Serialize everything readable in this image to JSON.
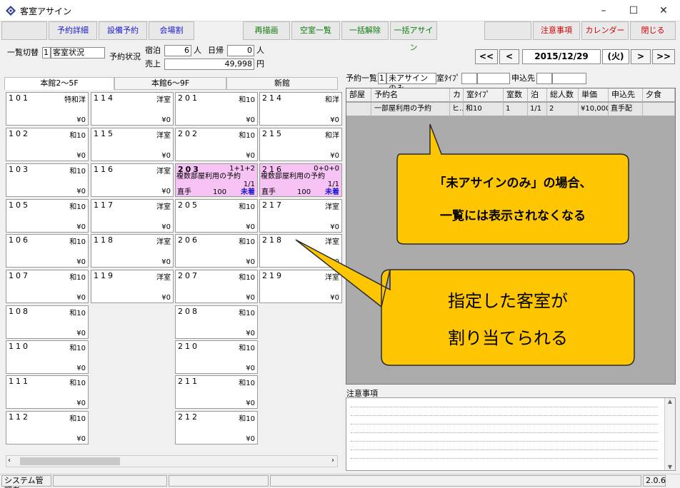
{
  "window": {
    "title": "客室アサイン",
    "minimize": "–",
    "maximize": "☐",
    "close": "✕"
  },
  "toolbar": {
    "yoyaku_shosai": "予約詳細",
    "setsubi_yoyaku": "設備予約",
    "kaijowari": "会場割",
    "saibyoga": "再描画",
    "kushitsu_ichiran": "空室一覧",
    "ikkatsu_kaijo": "一括解除",
    "ikkatsu_assign": "一括アサイン",
    "chuijiko": "注意事項",
    "calendar": "カレンダー",
    "tojiru": "閉じる"
  },
  "info": {
    "ichiran_kirikae_label": "一覧切替",
    "ichiran_kirikae_num": "1",
    "ichiran_kirikae_value": "客室状況",
    "yoyaku_jokyo_label": "予約状況",
    "shukuhaku_label": "宿泊",
    "shukuhaku_value": "6",
    "nin1": "人",
    "higaeri_label": "日帰",
    "higaeri_value": "0",
    "nin2": "人",
    "uriage_label": "売上",
    "uriage_value": "49,998",
    "yen": "円"
  },
  "datenav": {
    "first": "<<",
    "prev": "<",
    "date": "2015/12/29",
    "weekday": "(火)",
    "next": ">",
    "last": ">>"
  },
  "tabs": [
    "本館2～5F",
    "本館6～9F",
    "新館"
  ],
  "rooms": [
    {
      "no": "101",
      "type": "特和洋",
      "price": "¥0"
    },
    {
      "no": "114",
      "type": "洋室",
      "price": "¥0"
    },
    {
      "no": "201",
      "type": "和10",
      "price": "¥0"
    },
    {
      "no": "214",
      "type": "和洋",
      "price": "¥0"
    },
    {
      "no": "102",
      "type": "和10",
      "price": "¥0"
    },
    {
      "no": "115",
      "type": "洋室",
      "price": "¥0"
    },
    {
      "no": "202",
      "type": "和10",
      "price": "¥0"
    },
    {
      "no": "215",
      "type": "和洋",
      "price": "¥0"
    },
    {
      "no": "103",
      "type": "和10",
      "price": "¥0"
    },
    {
      "no": "116",
      "type": "洋室",
      "price": "¥0"
    },
    {
      "no": "105",
      "type": "和10",
      "price": "¥0"
    },
    {
      "no": "117",
      "type": "洋室",
      "price": "¥0"
    },
    {
      "no": "205",
      "type": "和10",
      "price": "¥0"
    },
    {
      "no": "217",
      "type": "洋室",
      "price": "¥0"
    },
    {
      "no": "106",
      "type": "和10",
      "price": "¥0"
    },
    {
      "no": "118",
      "type": "洋室",
      "price": "¥0"
    },
    {
      "no": "206",
      "type": "和10",
      "price": "¥0"
    },
    {
      "no": "218",
      "type": "洋室",
      "price": "¥0"
    },
    {
      "no": "107",
      "type": "和10",
      "price": "¥0"
    },
    {
      "no": "119",
      "type": "洋室",
      "price": "¥0"
    },
    {
      "no": "207",
      "type": "和10",
      "price": "¥0"
    },
    {
      "no": "219",
      "type": "洋室",
      "price": "¥0"
    },
    {
      "no": "108",
      "type": "和10",
      "price": "¥0"
    },
    {
      "no": "208",
      "type": "和10",
      "price": "¥0"
    },
    {
      "no": "110",
      "type": "和10",
      "price": "¥0"
    },
    {
      "no": "210",
      "type": "和10",
      "price": "¥0"
    },
    {
      "no": "111",
      "type": "和10",
      "price": "¥0"
    },
    {
      "no": "211",
      "type": "和10",
      "price": "¥0"
    },
    {
      "no": "112",
      "type": "和10",
      "price": "¥0"
    },
    {
      "no": "212",
      "type": "和10",
      "price": "¥0"
    }
  ],
  "booked": [
    {
      "no": "203",
      "count": "1+1+2",
      "name": "複数部屋利用の予約",
      "ratio": "1/1",
      "agent": "直手",
      "num": "100",
      "status": "未着"
    },
    {
      "no": "216",
      "count": "0+0+0",
      "name": "複数部屋利用の予約",
      "ratio": "1/1",
      "agent": "直手",
      "num": "100",
      "status": "未着"
    }
  ],
  "list": {
    "label": "予約一覧",
    "num": "1",
    "value": "未アサインのみ",
    "roomtype_label": "室ﾀｲﾌﾟ",
    "moshikomi_label": "申込先",
    "headers": [
      "部屋",
      "予約名",
      "カ",
      "室ﾀｲﾌﾟ",
      "室数",
      "泊",
      "総人数",
      "単価",
      "申込先",
      "夕食"
    ],
    "row": [
      "",
      "一部屋利用の予約",
      "ヒ..",
      "和10",
      "1",
      "1/1",
      "2",
      "¥10,000",
      "直手配",
      ""
    ]
  },
  "callouts": {
    "top_line1": "「未アサインのみ」の場合、",
    "top_line2": "一覧には表示されなくなる",
    "bottom_line1": "指定した客室が",
    "bottom_line2": "割り当てられる"
  },
  "notes": {
    "label": "注意事項"
  },
  "status": {
    "user": "システム管理者",
    "version": "2.0.6"
  },
  "colors": {
    "callout_fill": "#fdc600",
    "booked_bg": "#f7c3f5",
    "accent_blue": "#1a1ad0",
    "accent_red": "#d00000"
  }
}
